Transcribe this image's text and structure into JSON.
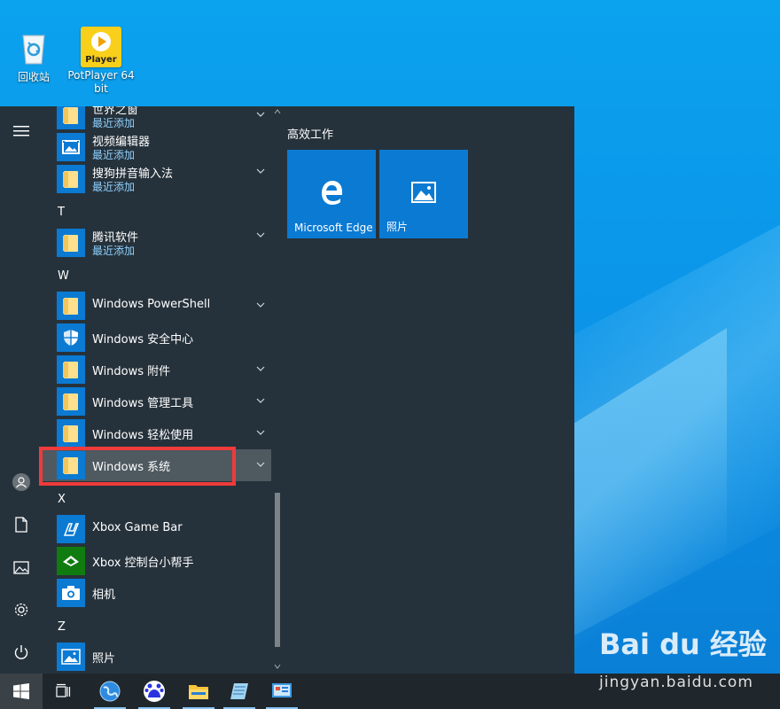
{
  "desktop": {
    "icons": [
      {
        "label": "回收站",
        "icon": "recycle-bin-icon"
      },
      {
        "label": "PotPlayer 64 bit",
        "badge": "Player",
        "icon": "potplayer-icon"
      }
    ]
  },
  "rail": {
    "items": [
      {
        "icon": "hamburger-menu-icon"
      },
      {
        "icon": "user-avatar-icon"
      },
      {
        "icon": "documents-icon"
      },
      {
        "icon": "pictures-icon"
      },
      {
        "icon": "settings-gear-icon"
      },
      {
        "icon": "power-icon"
      }
    ]
  },
  "app_list": {
    "sections": {
      "T": "T",
      "W": "W",
      "X": "X",
      "Z": "Z"
    },
    "items": [
      {
        "name": "世界之窗",
        "sub": "最近添加",
        "icon": "folder-icon",
        "expandable": true
      },
      {
        "name": "视频编辑器",
        "sub": "最近添加",
        "icon": "video-editor-icon",
        "expandable": false
      },
      {
        "name": "搜狗拼音输入法",
        "sub": "最近添加",
        "icon": "folder-icon",
        "expandable": true
      },
      {
        "name": "腾讯软件",
        "sub": "最近添加",
        "icon": "folder-icon",
        "expandable": true
      },
      {
        "name": "Windows PowerShell",
        "icon": "folder-icon",
        "expandable": true
      },
      {
        "name": "Windows 安全中心",
        "icon": "shield-icon",
        "expandable": false
      },
      {
        "name": "Windows 附件",
        "icon": "folder-icon",
        "expandable": true
      },
      {
        "name": "Windows 管理工具",
        "icon": "folder-icon",
        "expandable": true
      },
      {
        "name": "Windows 轻松使用",
        "icon": "folder-icon",
        "expandable": true
      },
      {
        "name": "Windows 系统",
        "icon": "folder-icon",
        "expandable": true,
        "highlighted": true
      },
      {
        "name": "Xbox Game Bar",
        "icon": "xbox-game-bar-icon",
        "expandable": false
      },
      {
        "name": "Xbox 控制台小帮手",
        "icon": "xbox-console-icon",
        "expandable": false
      },
      {
        "name": "相机",
        "icon": "camera-icon",
        "expandable": false
      },
      {
        "name": "照片",
        "icon": "photos-icon",
        "expandable": false
      }
    ]
  },
  "pinned": {
    "group_title": "高效工作",
    "tiles": [
      {
        "label": "Microsoft Edge",
        "icon": "edge-icon"
      },
      {
        "label": "照片",
        "icon": "photos-icon"
      }
    ]
  },
  "taskbar": {
    "items": [
      {
        "icon": "windows-start-icon"
      },
      {
        "icon": "task-view-icon"
      },
      {
        "icon": "browser-globe-icon"
      },
      {
        "icon": "baidu-icon"
      },
      {
        "icon": "file-explorer-icon"
      },
      {
        "icon": "notepad-icon"
      },
      {
        "icon": "control-panel-icon"
      }
    ]
  },
  "watermark": {
    "brand": "Bai du 经验",
    "url": "jingyan.baidu.com"
  },
  "colors": {
    "accent": "#0b7ad3",
    "start_bg": "#26323b",
    "highlight": "#ef3b3b",
    "recent_text": "#8fd1ff"
  }
}
